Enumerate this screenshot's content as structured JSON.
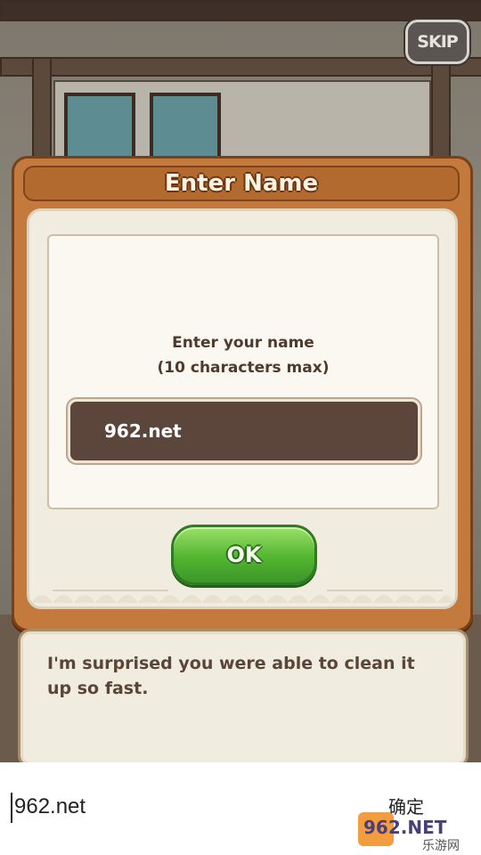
{
  "skip": {
    "label": "SKIP"
  },
  "dialog": {
    "title": "Enter Name",
    "prompt_line1": "Enter your name",
    "prompt_line2": "(10 characters max)",
    "name_value": "962.net",
    "ok_label": "OK"
  },
  "speech": {
    "text": "I'm surprised you were able to clean it up so fast."
  },
  "ime": {
    "input_value": "962.net",
    "confirm_label": "确定"
  },
  "watermark": {
    "brand": "962.NET",
    "caption": "乐游网"
  },
  "colors": {
    "dialog_frame": "#c47a3c",
    "dialog_body": "#f1ece0",
    "name_field": "#5c453a",
    "ok_green": "#52b52f",
    "watermark_orange": "#f08c1e"
  }
}
